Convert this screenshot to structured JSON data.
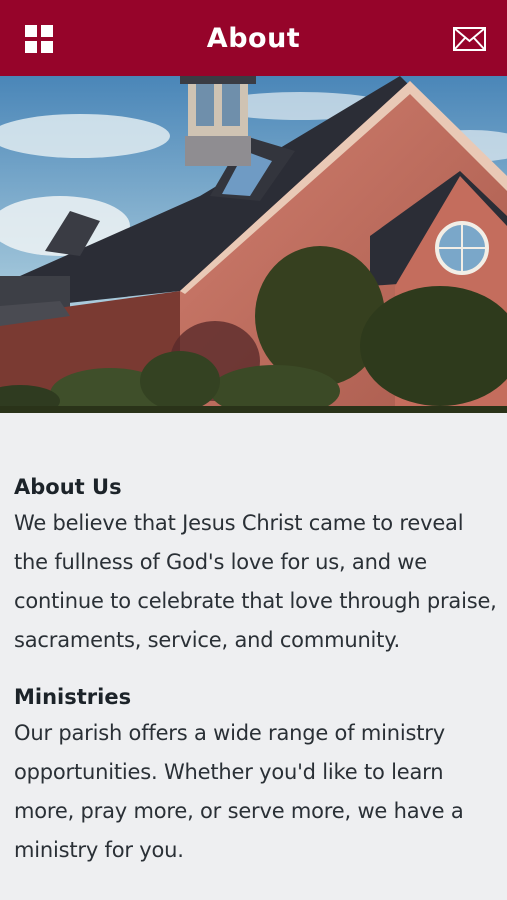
{
  "header": {
    "title": "About",
    "menu_icon": "grid-menu-icon",
    "mail_icon": "envelope-icon"
  },
  "colors": {
    "header_bg": "#96042a",
    "page_bg": "#eeeff1",
    "text": "#222a30"
  },
  "hero": {
    "image": "church-building-photo"
  },
  "sections": [
    {
      "title": "About Us",
      "body": "We believe that Jesus Christ came to reveal the fullness of God's love for us, and we continue to celebrate that love through praise, sacraments, service, and community."
    },
    {
      "title": "Ministries",
      "body": "Our parish offers a wide range of ministry opportunities. Whether you'd like to learn more, pray more, or serve more, we have a ministry for you."
    }
  ]
}
